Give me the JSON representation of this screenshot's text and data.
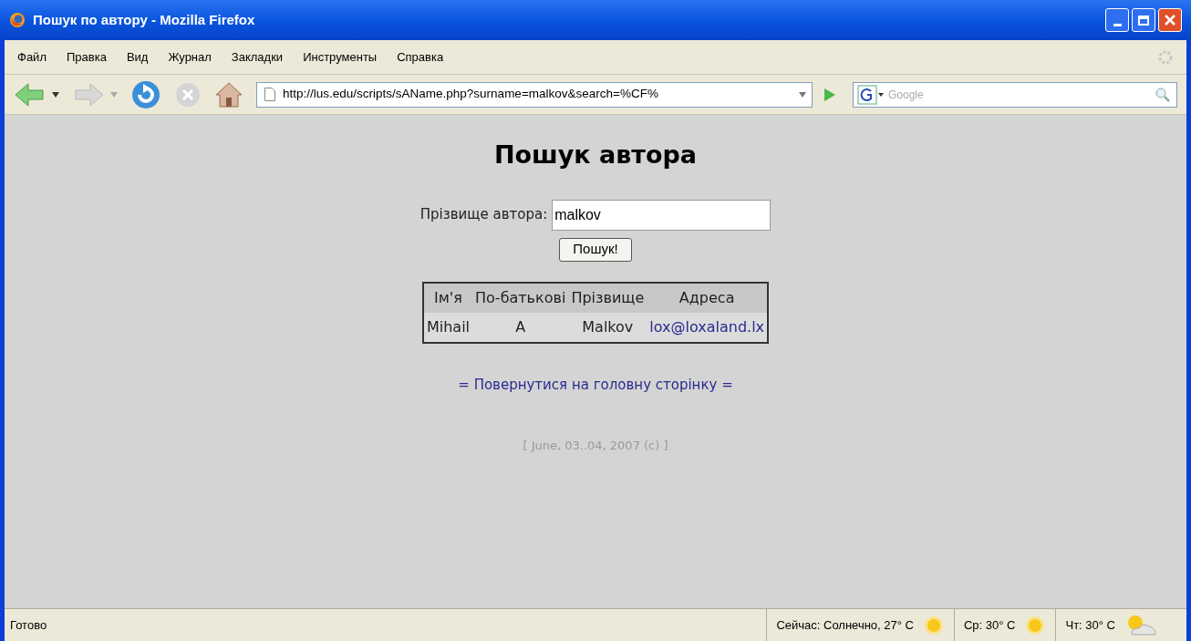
{
  "window": {
    "title": "Пошук по автору - Mozilla Firefox"
  },
  "menu": [
    "Файл",
    "Правка",
    "Вид",
    "Журнал",
    "Закладки",
    "Инструменты",
    "Справка"
  ],
  "toolbar": {
    "url": "http://lus.edu/scripts/sAName.php?surname=malkov&search=%CF%",
    "search_placeholder": "Google"
  },
  "page": {
    "heading": "Пошук автора",
    "field_label": "Прізвище автора:",
    "field_value": "malkov",
    "button": "Пошук!",
    "table": {
      "columns": [
        "Ім'я",
        "По-батькові",
        "Прізвище",
        "Адреса"
      ],
      "rows": [
        [
          {
            "text": "Mihail",
            "kind": "text"
          },
          {
            "text": "A",
            "kind": "text"
          },
          {
            "text": "Malkov",
            "kind": "text"
          },
          {
            "text": "lox@loxaland.lx",
            "kind": "link"
          }
        ]
      ]
    },
    "back_link": "= Повернутися на головну сторінку =",
    "footer": "[ June, 03..04, 2007 (c) ]"
  },
  "status_bar": {
    "text": "Готово",
    "weather": [
      {
        "text": "Сейчас: Солнечно, 27° C",
        "kind": "sunny"
      },
      {
        "text": "Ср: 30° C",
        "kind": "sunny"
      },
      {
        "text": "Чт: 30° C",
        "kind": "partly-cloudy"
      }
    ]
  }
}
